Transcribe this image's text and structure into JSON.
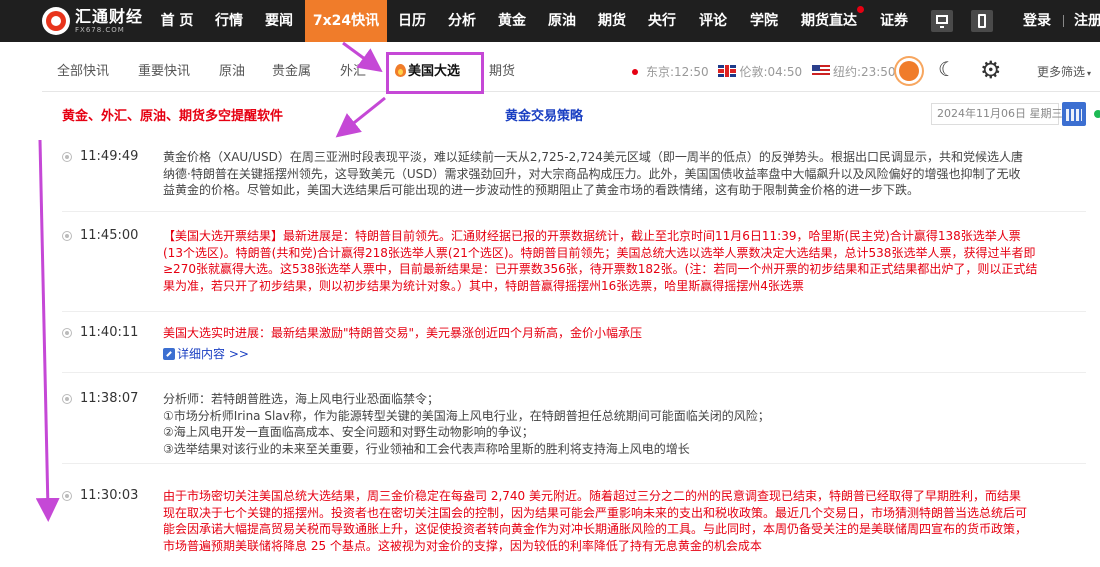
{
  "topnav": {
    "logo_name": "汇通财经",
    "logo_url": "FX678.COM",
    "items": [
      "首 页",
      "行情",
      "要闻",
      "7x24快讯",
      "日历",
      "分析",
      "黄金",
      "原油",
      "期货",
      "央行",
      "评论",
      "学院",
      "期货直达",
      "证券"
    ],
    "active_item": "7x24快讯",
    "login": "登录",
    "register": "注册"
  },
  "subnav": {
    "tabs": [
      "全部快讯",
      "重要快讯",
      "原油",
      "贵金属",
      "外汇",
      "美国大选",
      "期货"
    ],
    "highlighted_tab": "美国大选",
    "clocks": {
      "beijing": "东京:12:50",
      "london": "伦敦:04:50",
      "newyork": "纽约:23:50"
    },
    "more_filter": "更多筛选"
  },
  "promo": {
    "left": "黄金、外汇、原油、期货多空提醒软件",
    "middle": "黄金交易策略",
    "date": "2024年11月06日 星期三"
  },
  "feed": [
    {
      "time": "11:49:49",
      "style": "normal",
      "lines": [
        "黄金价格（XAU/USD）在周三亚洲时段表现平淡，难以延续前一天从2,725-2,724美元区域（即一周半的低点）的反弹势头。根据出口民调显示，共和党候选人唐",
        "纳德·特朗普在关键摇摆州领先，这导致美元（USD）需求强劲回升，对大宗商品构成压力。此外，美国国债收益率盘中大幅飙升以及风险偏好的增强也抑制了无收",
        "益黄金的价格。尽管如此，美国大选结果后可能出现的进一步波动性的预期阻止了黄金市场的看跌情绪，这有助于限制黄金价格的进一步下跌。"
      ]
    },
    {
      "time": "11:45:00",
      "style": "red",
      "lines": [
        "【美国大选开票结果】最新进展是：特朗普目前领先。汇通财经据已报的开票数据统计，截止至北京时间11月6日11:39，哈里斯(民主党)合计赢得138张选举人票",
        "(13个选区)。特朗普(共和党)合计赢得218张选举人票(21个选区)。特朗普目前领先；美国总统大选以选举人票数决定大选结果，总计538张选举人票，获得过半者即",
        "≥270张就赢得大选。这538张选举人票中，目前最新结果是：已开票数356张，待开票数182张。(注：若同一个州开票的初步结果和正式结果都出炉了，则以正式结",
        "果为准，若只开了初步结果，则以初步结果为统计对象。）其中，特朗普赢得摇摆州16张选票，哈里斯赢得摇摆州4张选票"
      ]
    },
    {
      "time": "11:40:11",
      "style": "red",
      "lines": [
        "美国大选实时进展：最新结果激励\"特朗普交易\"，美元暴涨创近四个月新高，金价小幅承压"
      ],
      "link": "详细内容 >>"
    },
    {
      "time": "11:38:07",
      "style": "normal",
      "lines": [
        "分析师：若特朗普胜选，海上风电行业恐面临禁令；",
        "①市场分析师Irina Slav称，作为能源转型关键的美国海上风电行业，在特朗普担任总统期间可能面临关闭的风险；",
        "②海上风电开发一直面临高成本、安全问题和对野生动物影响的争议；",
        "③选举结果对该行业的未来至关重要，行业领袖和工会代表声称哈里斯的胜利将支持海上风电的增长"
      ]
    },
    {
      "time": "11:30:03",
      "style": "red",
      "lines": [
        "由于市场密切关注美国总统大选结果，周三金价稳定在每盎司 2,740 美元附近。随着超过三分之二的州的民意调查现已结束，特朗普已经取得了早期胜利，而结果",
        "现在取决于七个关键的摇摆州。投资者也在密切关注国会的控制，因为结果可能会严重影响未来的支出和税收政策。最近几个交易日，市场猜测特朗普当选总统后可",
        "能会因承诺大幅提高贸易关税而导致通胀上升，这促使投资者转向黄金作为对冲长期通胀风险的工具。与此同时，本周仍备受关注的是美联储周四宣布的货币政策，",
        "市场普遍预期美联储将降息 25 个基点。这被视为对金价的支撑，因为较低的利率降低了持有无息黄金的机会成本"
      ]
    }
  ]
}
